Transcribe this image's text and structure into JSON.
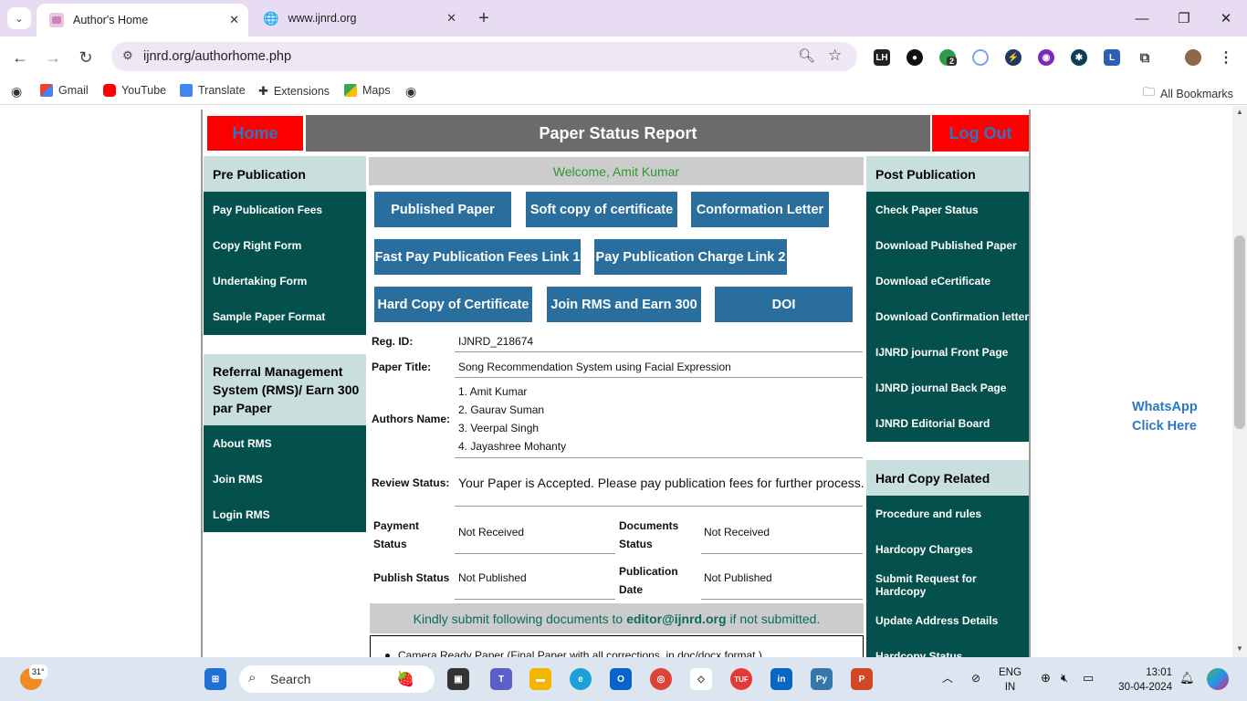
{
  "browser": {
    "tabs": [
      {
        "title": "Author's Home",
        "active": true
      },
      {
        "title": "www.ijnrd.org",
        "active": false
      }
    ],
    "url": "ijnrd.org/authorhome.php",
    "bookmarks": [
      "Gmail",
      "YouTube",
      "Translate",
      "Extensions",
      "Maps"
    ],
    "all_bookmarks": "All Bookmarks",
    "ext_badge": "2",
    "colors": {
      "tabstrip": "#e8dcf3",
      "omnibox": "#efe7f6"
    }
  },
  "header": {
    "home": "Home",
    "title": "Paper Status Report",
    "logout": "Log Out"
  },
  "pre_publication": {
    "heading": "Pre Publication",
    "items": [
      "Pay Publication Fees",
      "Copy Right Form",
      "Undertaking Form",
      "Sample Paper Format"
    ]
  },
  "rms": {
    "heading": "Referral Management System (RMS)/ Earn 300 par Paper",
    "items": [
      "About RMS",
      "Join RMS",
      "Login RMS"
    ]
  },
  "post_publication": {
    "heading": "Post Publication",
    "items": [
      "Check Paper Status",
      "Download Published Paper",
      "Download eCertificate",
      "Download Confirmation letter",
      "IJNRD journal Front Page",
      "IJNRD journal Back Page",
      "IJNRD Editorial Board"
    ]
  },
  "hard_copy": {
    "heading": "Hard Copy Related",
    "items": [
      "Procedure and rules",
      "Hardcopy Charges",
      "Submit Request for Hardcopy",
      "Update Address Details",
      "Hardcopy Status"
    ]
  },
  "welcome": "Welcome, Amit Kumar",
  "action_buttons": [
    "Published Paper",
    "Soft copy of certificate",
    "Conformation Letter",
    "Fast Pay Publication Fees Link 1",
    "Pay Publication Charge Link 2",
    "Hard Copy of Certificate",
    "Join RMS and Earn 300",
    "DOI"
  ],
  "details": {
    "reg_id_label": "Reg. ID:",
    "reg_id": "IJNRD_218674",
    "paper_title_label": "Paper Title:",
    "paper_title": "Song Recommendation System using Facial Expression",
    "authors_label": "Authors Name:",
    "authors": [
      "1. Amit Kumar",
      "2. Gaurav Suman",
      "3. Veerpal Singh",
      "4. Jayashree Mohanty"
    ],
    "review_label": "Review Status:",
    "review_status": "Your Paper is Accepted. Please pay publication fees for further process.",
    "payment_label": "Payment Status",
    "payment_status": "Not Received",
    "documents_label": "Documents Status",
    "documents_status": "Not Received",
    "publish_label": "Publish Status",
    "publish_status": "Not Published",
    "pubdate_label": "Publication Date",
    "pubdate": "Not Published"
  },
  "submit_notice": {
    "prefix": "Kindly submit following documents to",
    "email": "editor@ijnrd.org",
    "suffix": "if not submitted."
  },
  "documents": [
    "Camera Ready Paper (Final Paper with all corrections, in doc/docx format )"
  ],
  "whatsapp": {
    "line1": "WhatsApp",
    "line2": "Click Here"
  },
  "taskbar": {
    "weather": "31°",
    "search": "Search",
    "lang1": "ENG",
    "lang2": "IN",
    "time": "13:01",
    "date": "30-04-2024"
  },
  "colors": {
    "red": "#ff0000",
    "teal": "#03504d",
    "side_head": "#c8dfde",
    "blue_btn": "#2a6e9e",
    "link_blue": "#2a77c4"
  }
}
